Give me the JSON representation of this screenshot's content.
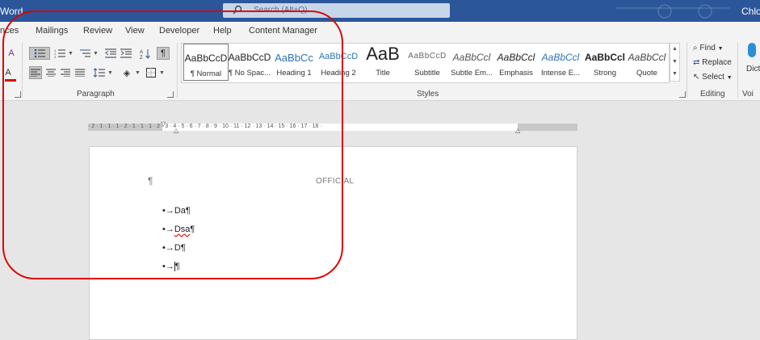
{
  "titlebar": {
    "app": "Word",
    "search_placeholder": "Search (Alt+Q)",
    "user": "Chlo"
  },
  "tabs": [
    "nces",
    "Mailings",
    "Review",
    "View",
    "Developer",
    "Help",
    "Content Manager"
  ],
  "ribbon": {
    "groups": {
      "paragraph": "Paragraph",
      "styles": "Styles",
      "editing": "Editing",
      "voice": "Voi"
    },
    "styles": [
      {
        "sample": "AaBbCcD",
        "name": "¶ Normal"
      },
      {
        "sample": "AaBbCcD",
        "name": "¶ No Spac..."
      },
      {
        "sample": "AaBbCc",
        "name": "Heading 1"
      },
      {
        "sample": "AaBbCcD",
        "name": "Heading 2"
      },
      {
        "sample": "AaB",
        "name": "Title"
      },
      {
        "sample": "AaBbCcD",
        "name": "Subtitle"
      },
      {
        "sample": "AaBbCcl",
        "name": "Subtle Em..."
      },
      {
        "sample": "AaBbCcl",
        "name": "Emphasis"
      },
      {
        "sample": "AaBbCcl",
        "name": "Intense E..."
      },
      {
        "sample": "AaBbCcl",
        "name": "Strong"
      },
      {
        "sample": "AaBbCcl",
        "name": "Quote"
      }
    ],
    "editing": {
      "find": "Find",
      "replace": "Replace",
      "select": "Select"
    },
    "dictate": "Dict"
  },
  "ruler": {
    "ticks": "· 2 · 1 · 1 · 1 · 2 · 1 · 1 · 1 · 2 · 3 · 4 · 5 · 6 · 7 · 8 · 9 · 10 · 11 · 12 · 13 · 14 · 15 · 16 · 17 · 18 ·"
  },
  "document": {
    "pilcrow": "¶",
    "header": "OFFICIAL",
    "bullets": [
      {
        "marker": "•→",
        "text": "Da",
        "mark": "¶",
        "spell_error": false
      },
      {
        "marker": "•→",
        "text": "Dsa",
        "mark": "¶",
        "spell_error": true
      },
      {
        "marker": "•→",
        "text": "D",
        "mark": "¶",
        "spell_error": false
      },
      {
        "marker": "•→",
        "text": "",
        "mark": "¶",
        "spell_error": false
      }
    ]
  },
  "colors": {
    "titlebar": "#2b579a",
    "annotation": "#e00000",
    "heading_blue": "#2e74b5"
  }
}
